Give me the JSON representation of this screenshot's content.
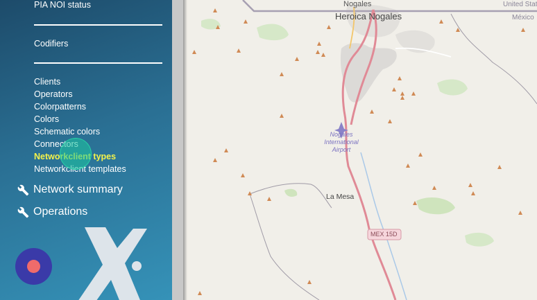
{
  "sidebar": {
    "top_item": "PIA NOI status",
    "codifiers": "Codifiers",
    "items": [
      {
        "label": "Clients"
      },
      {
        "label": "Operators"
      },
      {
        "label": "Colorpatterns"
      },
      {
        "label": "Colors"
      },
      {
        "label": "Schematic colors"
      },
      {
        "label": "Connectors"
      },
      {
        "label": "Networkclient types"
      },
      {
        "label": "Networkclient templates"
      }
    ],
    "active_index": 6,
    "sections": [
      {
        "label": "Network summary",
        "icon": "wrench-icon"
      },
      {
        "label": "Operations",
        "icon": "wrench-icon"
      }
    ]
  },
  "map": {
    "labels": {
      "nogales_small": "Nogales",
      "heroica_nogales": "Heroica Nogales",
      "united_states": "United Stat",
      "mexico": "México",
      "airport": "Nogales\nInternational\nAirport",
      "la_mesa": "La Mesa",
      "highway": "MEX 15D"
    }
  },
  "colors": {
    "sidebar_active": "#f4f24a",
    "record_button": "#3a3aa8",
    "record_dot": "#ef6b6b",
    "peak_marker": "#d08a55"
  }
}
